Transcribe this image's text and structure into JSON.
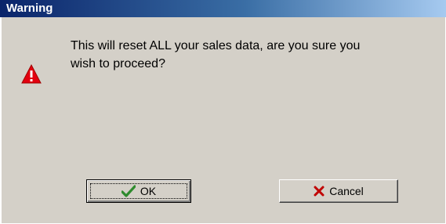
{
  "window": {
    "title": "Warning"
  },
  "dialog": {
    "icon": "warning-triangle-icon",
    "message_line1": "This will reset ALL your sales data, are you sure you",
    "message_line2": "wish to proceed?"
  },
  "buttons": {
    "ok_label": "OK",
    "ok_icon": "checkmark-icon",
    "cancel_label": "Cancel",
    "cancel_icon": "x-icon"
  },
  "colors": {
    "titlebar_start": "#0a246a",
    "titlebar_end": "#a6caf0",
    "dialog_bg": "#d4d0c8",
    "warning_red": "#e3000f",
    "check_green": "#2e8b2e",
    "x_red": "#c00000"
  }
}
